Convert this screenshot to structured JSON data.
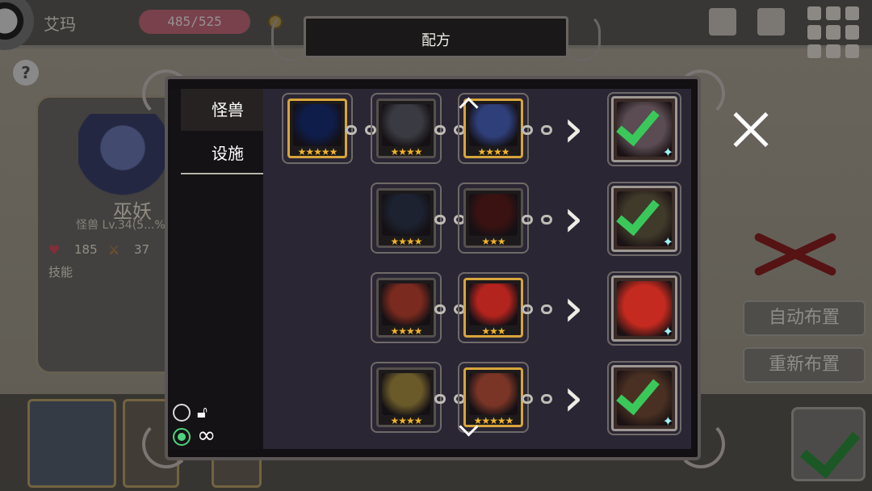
{
  "hud": {
    "player_name": "艾玛",
    "hp_text": "485/525"
  },
  "info_card": {
    "name": "巫妖",
    "subtitle": "怪兽 Lv.34(5...%)",
    "hp": "185",
    "attack": "37",
    "skill_label": "技能"
  },
  "side_buttons": {
    "auto_place": "自动布置",
    "re_place": "重新布置"
  },
  "dialog": {
    "title": "配方",
    "tabs": [
      {
        "label": "怪兽",
        "active": true
      },
      {
        "label": "设施",
        "active": false
      }
    ],
    "lock_icon": "lock-icon",
    "infinity_icon": "infinity-icon",
    "infinity_glyph": "∞"
  },
  "recipes": [
    {
      "inputs": [
        {
          "name": "hooded-ghost",
          "stars": 5,
          "color": "#0f1d4a",
          "gold": true
        },
        {
          "name": "dark-skeleton",
          "stars": 4,
          "color": "#3a3b42",
          "gold": false
        },
        {
          "name": "lich-witch",
          "stars": 4,
          "color": "#2f3f7a",
          "gold": true
        }
      ],
      "result": {
        "name": "shadow-result",
        "color": "#5a4c52",
        "checked": true,
        "gem": "✦"
      }
    },
    {
      "inputs": [
        {
          "name": "dark-girl",
          "stars": 4,
          "color": "#1c2230",
          "gold": false
        },
        {
          "name": "red-dragon-dark",
          "stars": 3,
          "color": "#3a1212",
          "gold": false
        }
      ],
      "result": {
        "name": "dark-knight-result",
        "color": "#3f3a2a",
        "checked": true,
        "gem": "✦"
      }
    },
    {
      "inputs": [
        {
          "name": "fire-girl",
          "stars": 4,
          "color": "#7a2a1e",
          "gold": false
        },
        {
          "name": "red-dragon",
          "stars": 3,
          "color": "#b3241e",
          "gold": true
        }
      ],
      "result": {
        "name": "flame-maiden-result",
        "color": "#c42a1f",
        "checked": false,
        "gem": "✦"
      }
    },
    {
      "inputs": [
        {
          "name": "flower-fairy",
          "stars": 4,
          "color": "#6a5a2a",
          "gold": false
        },
        {
          "name": "red-warrior",
          "stars": 5,
          "color": "#7a3526",
          "gold": true
        }
      ],
      "result": {
        "name": "rose-result",
        "color": "#4a3022",
        "checked": true,
        "gem": "✦"
      }
    }
  ]
}
